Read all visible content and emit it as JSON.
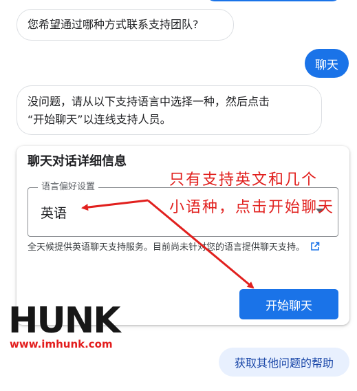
{
  "chat": {
    "bot_question": "您希望通过哪种方式联系支持团队?",
    "user_reply": "聊天",
    "bot_reply_line1": "没问题，请从以下支持语言中选择一种，然后点击",
    "bot_reply_line2": "“开始聊天”以连线支持人员。"
  },
  "card": {
    "title": "聊天对话详细信息",
    "language_label": "语言偏好设置",
    "language_value": "英语",
    "note": "全天候提供英语聊天支持服务。目前尚未针对您的语言提供聊天支持。",
    "start_button": "开始聊天"
  },
  "help_chip": "获取其他问题的帮助",
  "annotation": {
    "line1": "只有支持英文和几个",
    "line2": "小语种，点击开始聊天",
    "color": "#e1201e"
  },
  "watermark": {
    "logo": "HUNK",
    "url": "www.imhunk.com"
  },
  "colors": {
    "primary": "#1a73e8",
    "chip_bg": "#e8f0fe"
  }
}
